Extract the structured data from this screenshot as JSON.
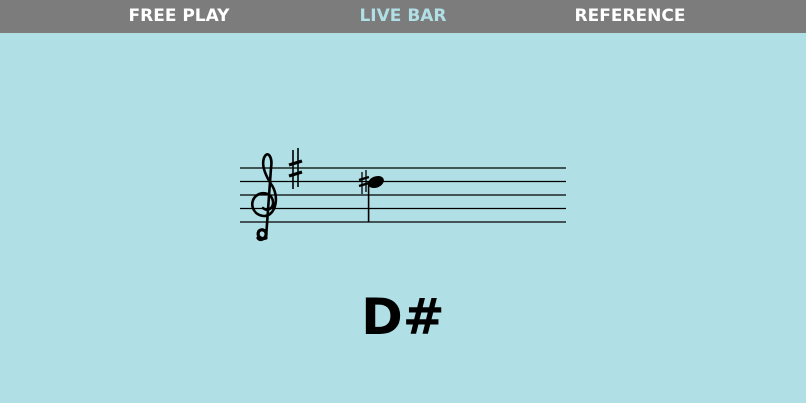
{
  "nav": {
    "tabs": [
      {
        "label": "FREE PLAY",
        "active": false
      },
      {
        "label": "LIVE BAR",
        "active": true
      },
      {
        "label": "REFERENCE",
        "active": false
      }
    ]
  },
  "staff": {
    "clef": "treble",
    "key_signature": "F#",
    "note": {
      "pitch": "D#5",
      "accidental": "sharp"
    }
  },
  "note_name": "D#",
  "colors": {
    "background": "#b0dfe5",
    "nav_background": "#7c7c7c",
    "nav_text": "#ffffff",
    "nav_active_text": "#b0dfe5",
    "ink": "#000000"
  },
  "icons": {
    "clef": "treble-clef-icon",
    "key_sharp": "sharp-icon",
    "accidental": "sharp-icon"
  }
}
